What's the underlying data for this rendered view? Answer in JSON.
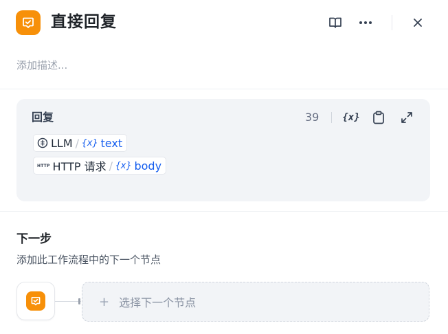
{
  "header": {
    "title": "直接回复",
    "node_icon": "answer-node-icon",
    "actions": [
      "book-icon",
      "more-icon",
      "close-icon"
    ]
  },
  "description_placeholder": "添加描述...",
  "reply": {
    "label": "回复",
    "char_count": "39",
    "actions": [
      "variable-insert-icon",
      "clipboard-icon",
      "expand-icon"
    ],
    "variable_symbol": "{x}",
    "variables": [
      {
        "node": "LLM",
        "node_icon": "llm-icon",
        "separator": "/",
        "var_symbol": "{x}",
        "var_name": "text"
      },
      {
        "node": "HTTP 请求",
        "node_icon_text": "HTTP",
        "separator": "/",
        "var_symbol": "{x}",
        "var_name": "body"
      }
    ]
  },
  "next_step": {
    "title": "下一步",
    "description": "添加此工作流程中的下一个节点",
    "select_label": "选择下一个节点",
    "plus": "+"
  },
  "colors": {
    "accent_orange": "#f79009",
    "variable_blue": "#155eef",
    "card_bg": "#f2f4f7"
  }
}
